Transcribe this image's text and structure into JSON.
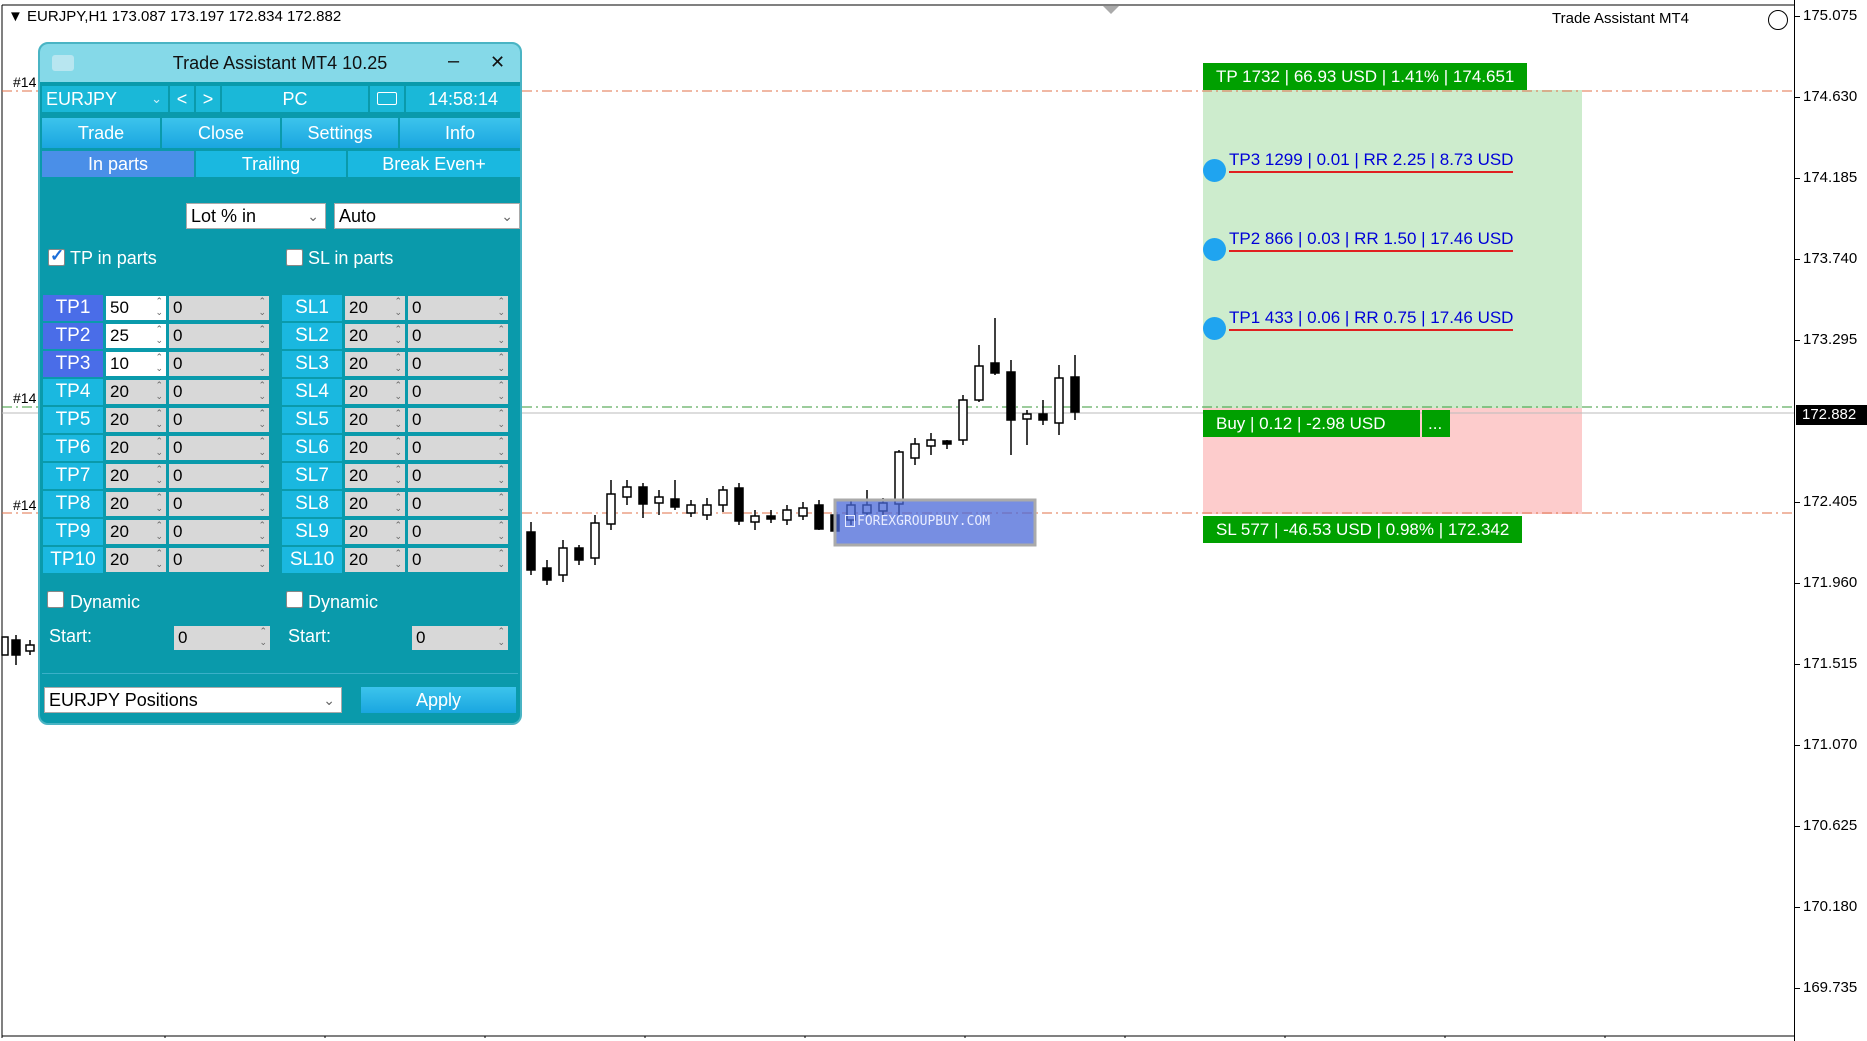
{
  "chart": {
    "symbol_header": "EURJPY,H1  173.087 173.197 172.834 172.882",
    "ea_title": "Trade Assistant MT4",
    "price_labels": [
      "175.075",
      "174.630",
      "174.185",
      "173.740",
      "173.295",
      "172.405",
      "171.960",
      "171.515",
      "171.070",
      "170.625",
      "170.180",
      "169.735"
    ],
    "current_price": "172.882",
    "order_label_1": "#14",
    "order_label_2": "#14",
    "order_label_3": "#14",
    "tp_tag": "TP 1732 | 66.93 USD | 1.41% | 174.651",
    "tp3_partial": "TP3 1299 | 0.01 | RR 2.25 | 8.73 USD",
    "tp2_partial": "TP2 866 | 0.03 | RR 1.50 | 17.46 USD",
    "tp1_partial": "TP1 433 | 0.06 | RR 0.75 | 17.46 USD",
    "buy_tag": "Buy | 0.12 | -2.98 USD",
    "buy_more": "...",
    "sl_tag": "SL 577 | -46.53 USD | 0.98% | 172.342",
    "watermark": "FOREXGROUPBUY.COM",
    "colors": {
      "tp_zone": "#cdeccd",
      "sl_zone": "#fdcccc",
      "tag_green": "#00a000",
      "partial_text": "#0000d8"
    }
  },
  "panel": {
    "title": "Trade Assistant MT4 10.25",
    "minimize": "–",
    "close": "✕",
    "symbol": "EURJPY",
    "prev": "<",
    "next": ">",
    "account": "PC",
    "clock": "14:58:14",
    "tabs": [
      "Trade",
      "Close",
      "Settings",
      "Info"
    ],
    "subtabs": [
      "In parts",
      "Trailing",
      "Break Even+"
    ],
    "lot_mode": "Lot % in",
    "mode_value": "Auto",
    "tp_in_parts_label": "TP in parts",
    "tp_in_parts_checked": true,
    "sl_in_parts_label": "SL in parts",
    "sl_in_parts_checked": false,
    "tp_levels": [
      {
        "label": "TP1",
        "pct": "50",
        "val": "0"
      },
      {
        "label": "TP2",
        "pct": "25",
        "val": "0"
      },
      {
        "label": "TP3",
        "pct": "10",
        "val": "0"
      },
      {
        "label": "TP4",
        "pct": "20",
        "val": "0"
      },
      {
        "label": "TP5",
        "pct": "20",
        "val": "0"
      },
      {
        "label": "TP6",
        "pct": "20",
        "val": "0"
      },
      {
        "label": "TP7",
        "pct": "20",
        "val": "0"
      },
      {
        "label": "TP8",
        "pct": "20",
        "val": "0"
      },
      {
        "label": "TP9",
        "pct": "20",
        "val": "0"
      },
      {
        "label": "TP10",
        "pct": "20",
        "val": "0"
      }
    ],
    "sl_levels": [
      {
        "label": "SL1",
        "pct": "20",
        "val": "0"
      },
      {
        "label": "SL2",
        "pct": "20",
        "val": "0"
      },
      {
        "label": "SL3",
        "pct": "20",
        "val": "0"
      },
      {
        "label": "SL4",
        "pct": "20",
        "val": "0"
      },
      {
        "label": "SL5",
        "pct": "20",
        "val": "0"
      },
      {
        "label": "SL6",
        "pct": "20",
        "val": "0"
      },
      {
        "label": "SL7",
        "pct": "20",
        "val": "0"
      },
      {
        "label": "SL8",
        "pct": "20",
        "val": "0"
      },
      {
        "label": "SL9",
        "pct": "20",
        "val": "0"
      },
      {
        "label": "SL10",
        "pct": "20",
        "val": "0"
      }
    ],
    "dynamic_label": "Dynamic",
    "start_label": "Start:",
    "tp_start": "0",
    "sl_start": "0",
    "positions_select": "EURJPY Positions",
    "apply_label": "Apply"
  }
}
